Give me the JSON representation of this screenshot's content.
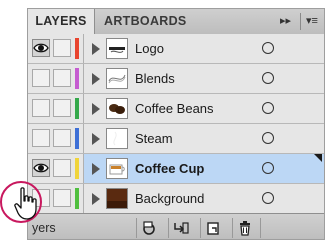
{
  "tabs": {
    "layers": "LAYERS",
    "artboards": "ARTBOARDS",
    "forward": "▸▸",
    "menu": "▾≡"
  },
  "layers": [
    {
      "name": "Logo",
      "color": "#e8442e",
      "visible": true,
      "selected": false,
      "thumb": "logo"
    },
    {
      "name": "Blends",
      "color": "#c55bd0",
      "visible": false,
      "selected": false,
      "thumb": "blends"
    },
    {
      "name": "Coffee Beans",
      "color": "#34a84a",
      "visible": false,
      "selected": false,
      "thumb": "beans"
    },
    {
      "name": "Steam",
      "color": "#3d6fd6",
      "visible": false,
      "selected": false,
      "thumb": "steam"
    },
    {
      "name": "Coffee Cup",
      "color": "#f0d43a",
      "visible": true,
      "selected": true,
      "thumb": "cup"
    },
    {
      "name": "Background",
      "color": "#4fbf3e",
      "visible": false,
      "selected": false,
      "thumb": "background"
    }
  ],
  "bottombar": {
    "label": "yers"
  },
  "icons": [
    "eye-icon",
    "disclosure-arrow-icon",
    "target-circle-icon",
    "make-clipping-mask-icon",
    "create-sublayer-icon",
    "new-layer-icon",
    "trash-icon",
    "hand-cursor-icon"
  ]
}
